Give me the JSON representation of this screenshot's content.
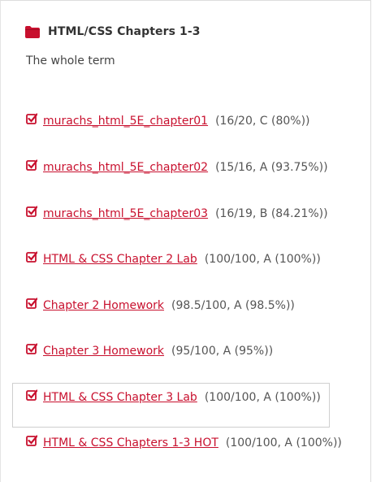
{
  "module": {
    "icon": "folder-icon",
    "title": "HTML/CSS Chapters 1-3",
    "description": "The whole term"
  },
  "colors": {
    "accent": "#c8102e",
    "text": "#444444"
  },
  "items": [
    {
      "icon": "check-icon",
      "title": "murachs_html_5E_chapter01",
      "grade": "(16/20, C (80%))"
    },
    {
      "icon": "check-icon",
      "title": "murachs_html_5E_chapter02",
      "grade": "(15/16, A (93.75%))"
    },
    {
      "icon": "check-icon",
      "title": "murachs_html_5E_chapter03",
      "grade": "(16/19, B (84.21%))"
    },
    {
      "icon": "check-icon",
      "title": "HTML & CSS Chapter 2 Lab",
      "grade": "(100/100, A (100%))"
    },
    {
      "icon": "check-icon",
      "title": "Chapter 2 Homework",
      "grade": "(98.5/100, A (98.5%))"
    },
    {
      "icon": "check-icon",
      "title": "Chapter 3 Homework",
      "grade": "(95/100, A (95%))"
    },
    {
      "icon": "check-icon",
      "title": "HTML & CSS Chapter 3 Lab",
      "grade": "(100/100, A (100%))"
    },
    {
      "icon": "check-icon",
      "title": "HTML & CSS Chapters 1-3 HOT",
      "grade": "(100/100, A (100%))"
    }
  ]
}
